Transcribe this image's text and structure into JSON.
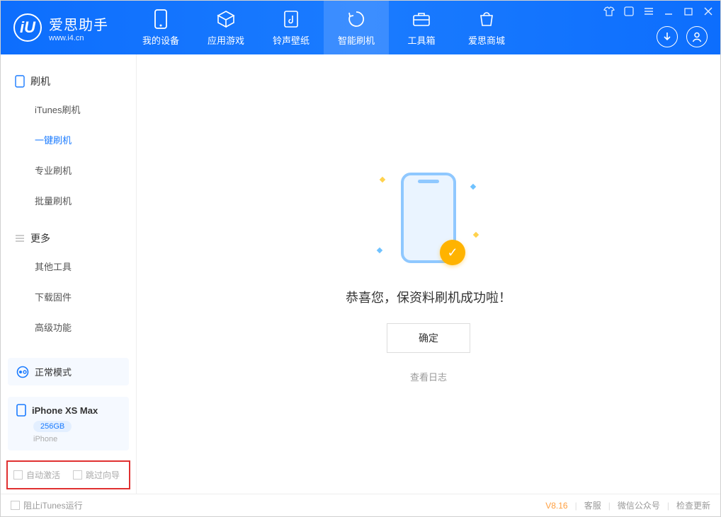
{
  "app": {
    "name": "爱思助手",
    "url": "www.i4.cn"
  },
  "nav": {
    "items": [
      {
        "label": "我的设备"
      },
      {
        "label": "应用游戏"
      },
      {
        "label": "铃声壁纸"
      },
      {
        "label": "智能刷机"
      },
      {
        "label": "工具箱"
      },
      {
        "label": "爱思商城"
      }
    ],
    "activeIndex": 3
  },
  "sidebar": {
    "group1": {
      "title": "刷机",
      "items": [
        "iTunes刷机",
        "一键刷机",
        "专业刷机",
        "批量刷机"
      ],
      "activeIndex": 1
    },
    "group2": {
      "title": "更多",
      "items": [
        "其他工具",
        "下载固件",
        "高级功能"
      ]
    }
  },
  "device": {
    "modeLabel": "正常模式",
    "name": "iPhone XS Max",
    "storage": "256GB",
    "type": "iPhone"
  },
  "options": {
    "autoActivate": "自动激活",
    "skipGuide": "跳过向导"
  },
  "main": {
    "successTitle": "恭喜您，保资料刷机成功啦！",
    "okButton": "确定",
    "viewLog": "查看日志"
  },
  "footer": {
    "blockItunes": "阻止iTunes运行",
    "version": "V8.16",
    "links": [
      "客服",
      "微信公众号",
      "检查更新"
    ]
  }
}
